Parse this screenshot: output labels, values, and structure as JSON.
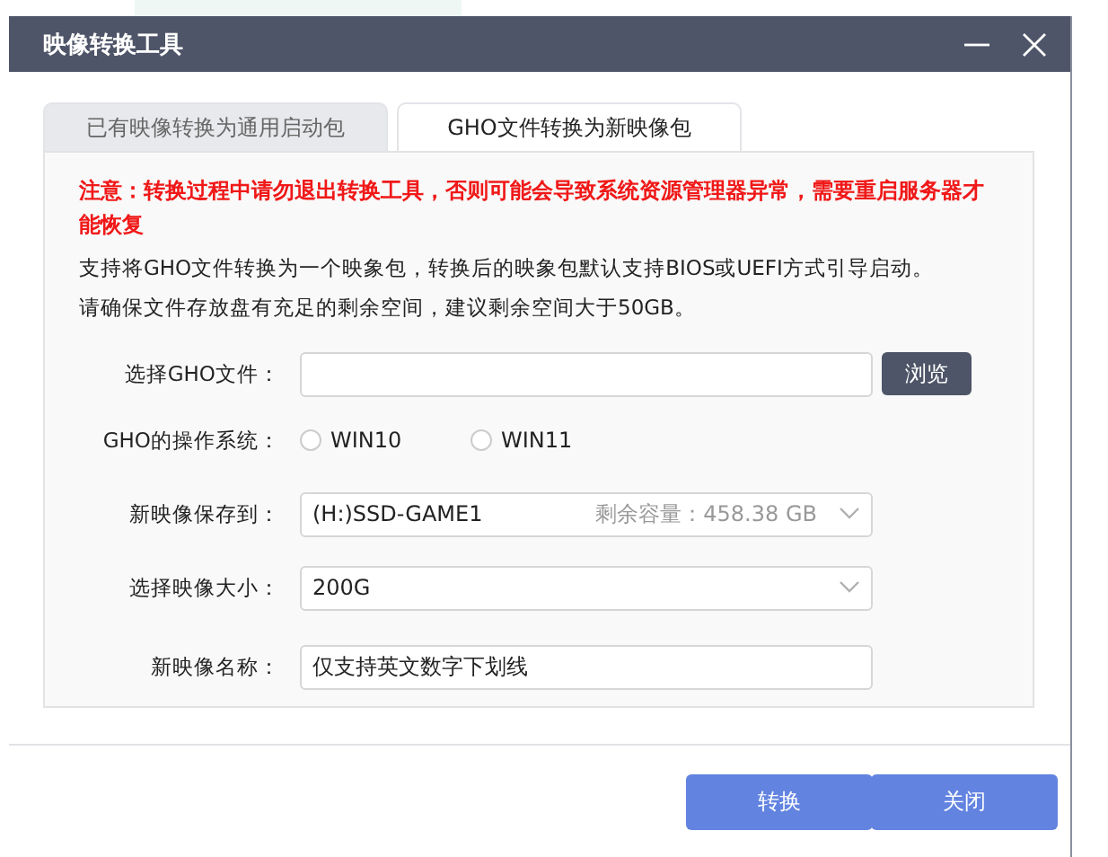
{
  "window": {
    "title": "映像转换工具"
  },
  "tabs": [
    {
      "label": "已有映像转换为通用启动包",
      "selected": false
    },
    {
      "label": "GHO文件转换为新映像包",
      "selected": true
    }
  ],
  "notice": {
    "warning": "注意：转换过程中请勿退出转换工具，否则可能会导致系统资源管理器异常，需要重启服务器才能恢复",
    "lines": [
      "支持将GHO文件转换为一个映象包，转换后的映象包默认支持BIOS或UEFI方式引导启动。",
      "请确保文件存放盘有充足的剩余空间，建议剩余空间大于50GB。"
    ]
  },
  "form": [
    {
      "kind": "file",
      "label": "选择GHO文件：",
      "button": "浏览"
    },
    {
      "kind": "radio",
      "label": "GHO的操作系统：",
      "options": [
        {
          "label": "WIN10",
          "selected": false
        },
        {
          "label": "WIN11",
          "selected": false
        }
      ]
    },
    {
      "kind": "select",
      "label": "新映像保存到：",
      "value": "(H:)SSD-GAME1",
      "note": "剩余容量：458.38 GB"
    },
    {
      "kind": "select",
      "label": "选择映像大小：",
      "value": "200G"
    },
    {
      "kind": "text",
      "label": "新映像名称：",
      "placeholder": "仅支持英文数字下划线"
    }
  ],
  "buttons": [
    "转换",
    "关闭"
  ]
}
